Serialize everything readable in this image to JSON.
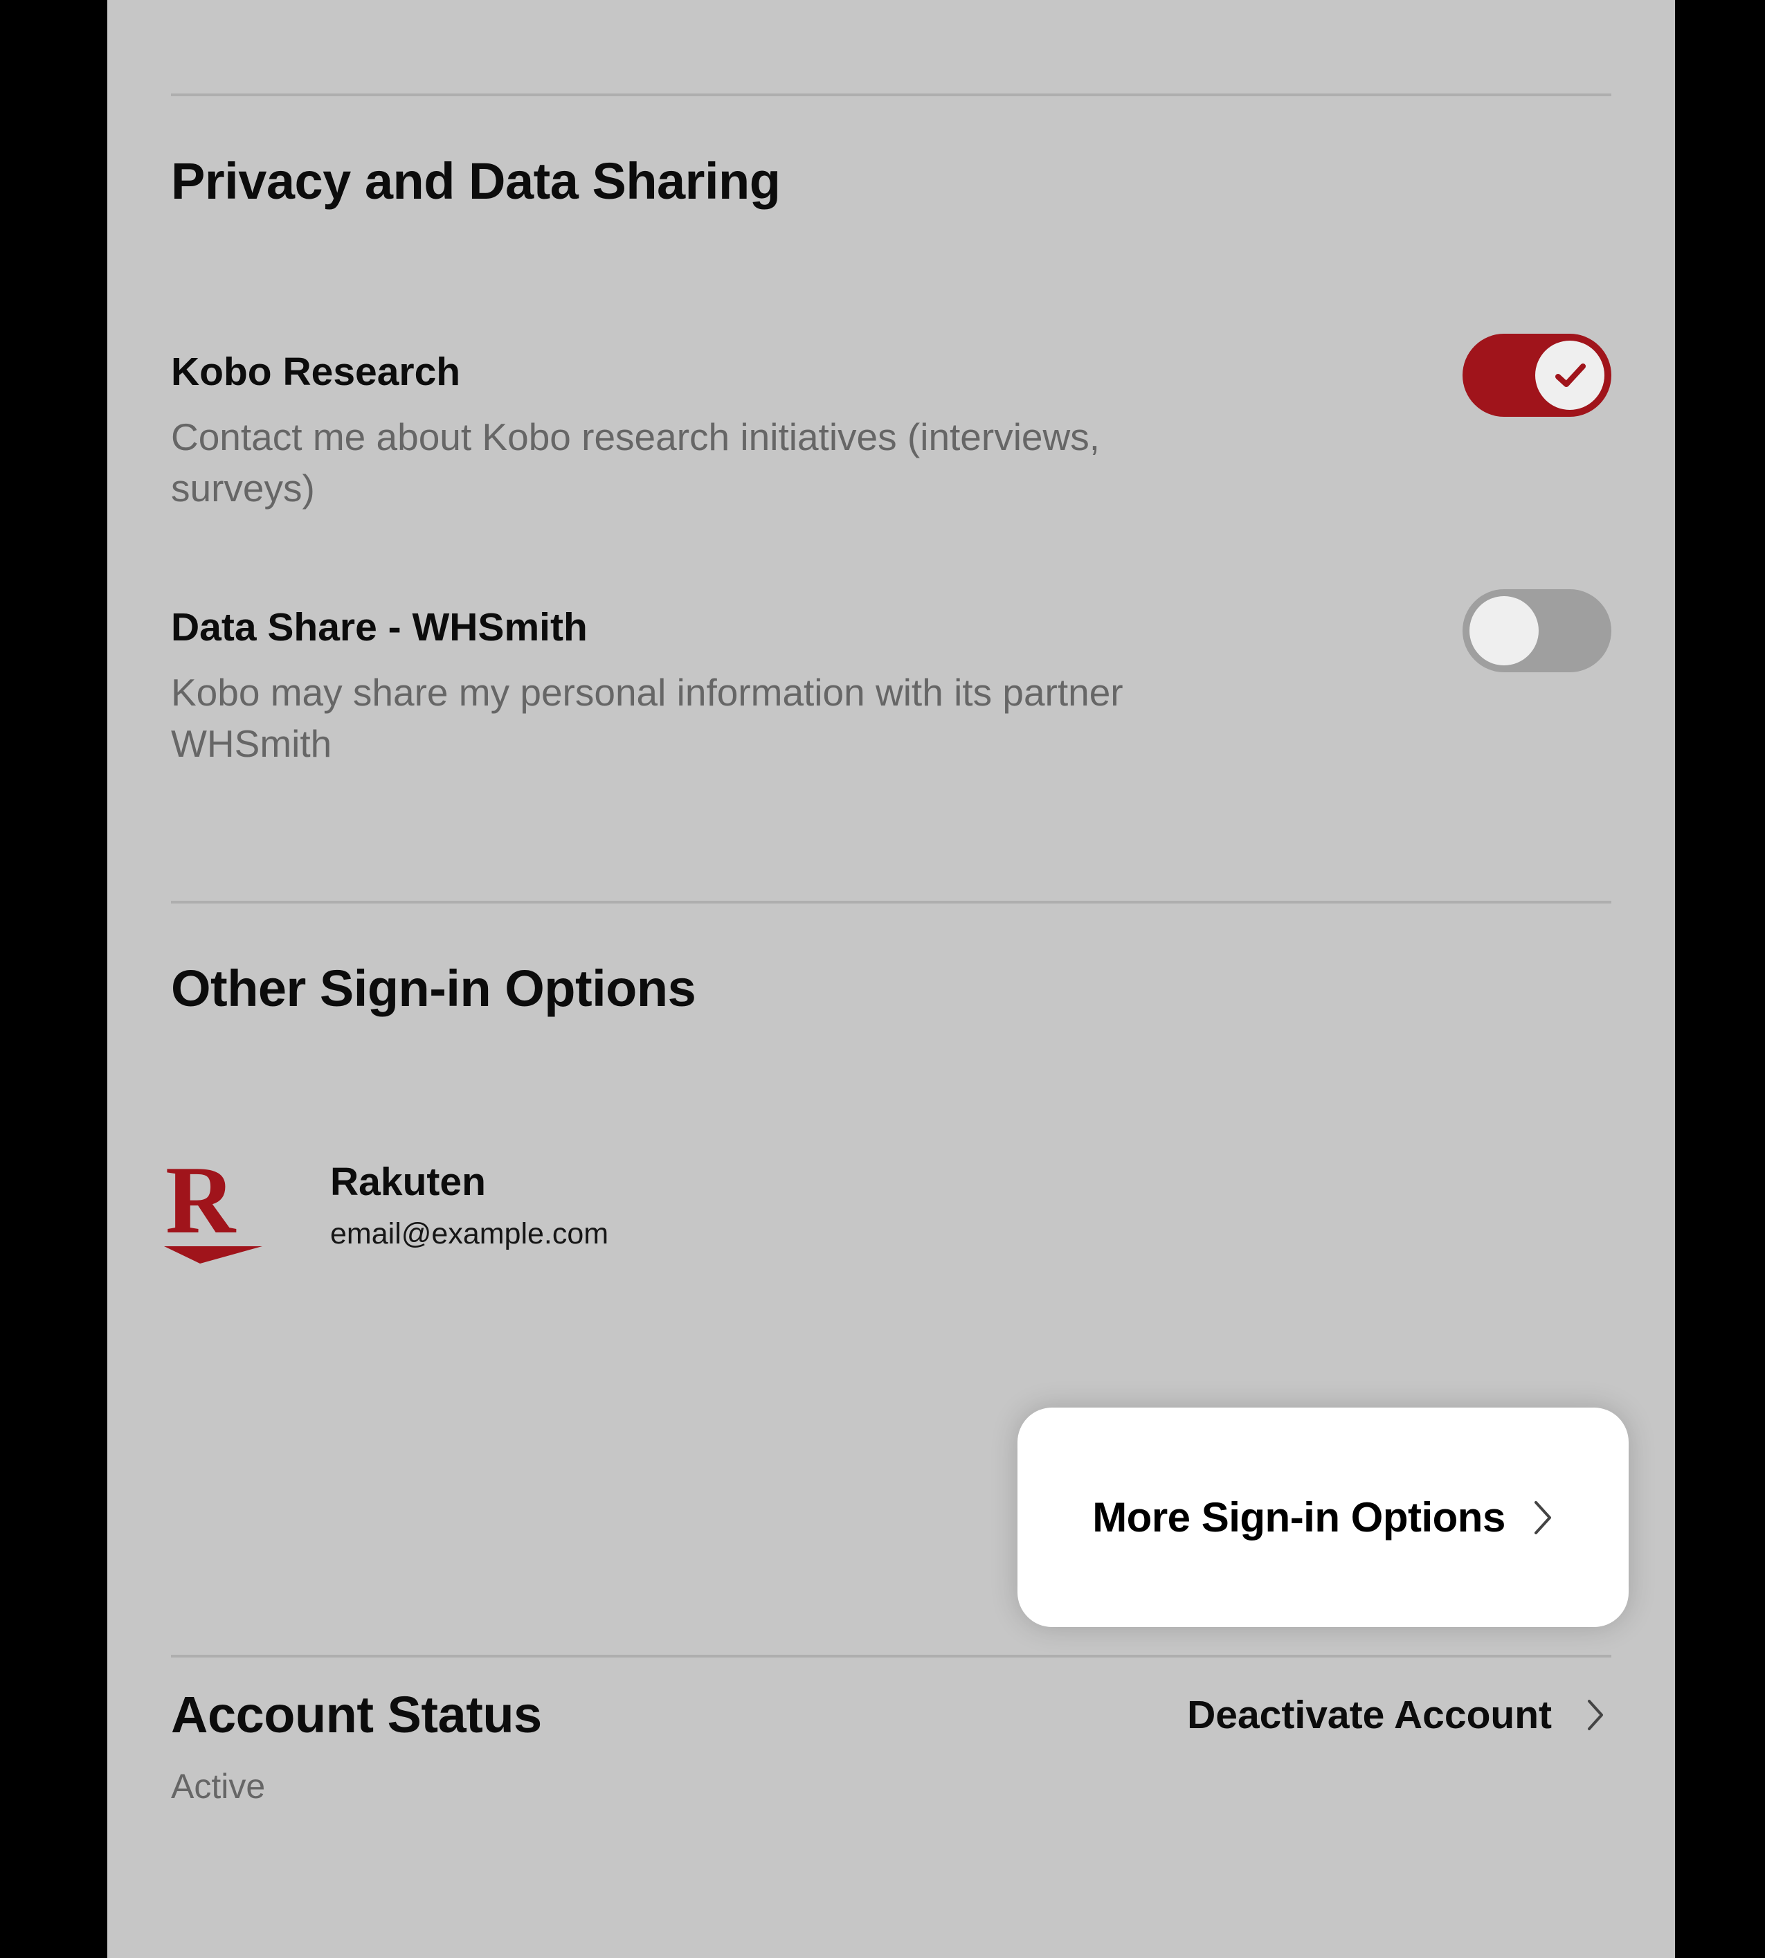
{
  "privacy": {
    "heading": "Privacy and Data Sharing",
    "items": [
      {
        "title": "Kobo Research",
        "desc": "Contact me about Kobo research initiatives (interviews, surveys)",
        "enabled": true
      },
      {
        "title": "Data Share - WHSmith",
        "desc": "Kobo may share my personal information with its partner WHSmith",
        "enabled": false
      }
    ]
  },
  "signin": {
    "heading": "Other Sign-in Options",
    "provider": {
      "name": "Rakuten",
      "email": "email@example.com"
    },
    "more_label": "More Sign-in Options"
  },
  "status": {
    "heading": "Account Status",
    "value": "Active",
    "action_label": "Deactivate Account"
  }
}
